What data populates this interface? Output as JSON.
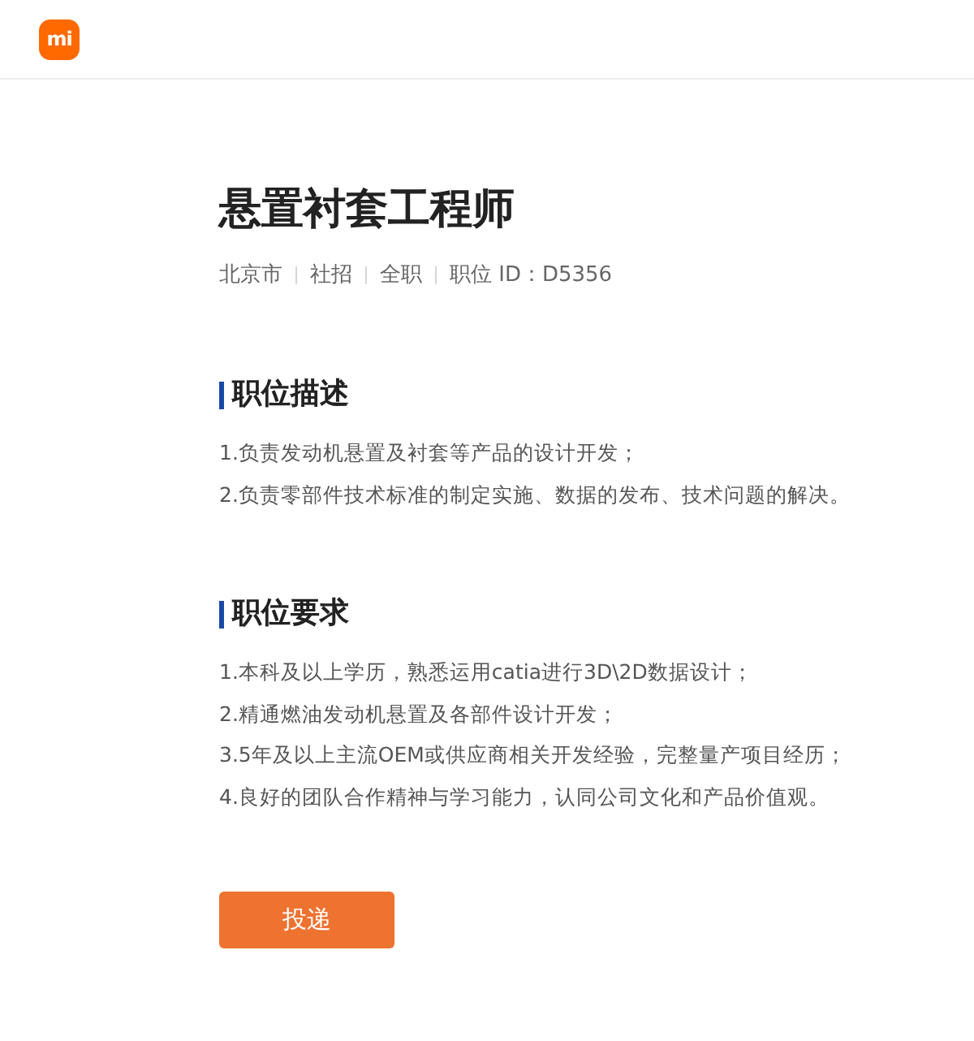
{
  "header": {
    "logo": "mi"
  },
  "job": {
    "title": "悬置衬套工程师",
    "meta": [
      "北京市",
      "社招",
      "全职",
      "职位 ID：D5356"
    ]
  },
  "sections": [
    {
      "heading": "职位描述",
      "items": [
        "1.负责发动机悬置及衬套等产品的设计开发；",
        "2.负责零部件技术标准的制定实施、数据的发布、技术问题的解决。"
      ]
    },
    {
      "heading": "职位要求",
      "items": [
        "1.本科及以上学历，熟悉运用catia进行3D\\2D数据设计；",
        "2.精通燃油发动机悬置及各部件设计开发；",
        "3.5年及以上主流OEM或供应商相关开发经验，完整量产项目经历；",
        "4.良好的团队合作精神与学习能力，认同公司文化和产品价值观。"
      ]
    }
  ],
  "apply_button": "投递"
}
